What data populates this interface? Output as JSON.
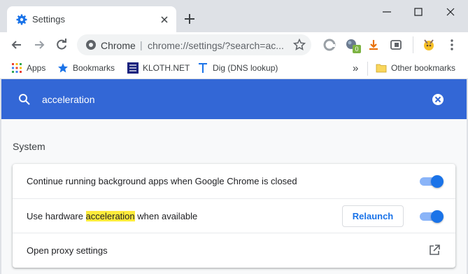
{
  "tab": {
    "title": "Settings"
  },
  "omnibox": {
    "site_label": "Chrome",
    "separator": "|",
    "url": "chrome://settings/?search=ac..."
  },
  "extensions": {
    "badge_count": "0"
  },
  "bookmarks": {
    "items": [
      "Apps",
      "Bookmarks",
      "KLOTH.NET",
      "Dig (DNS lookup)"
    ],
    "overflow": "»",
    "other": "Other bookmarks"
  },
  "search": {
    "value": "acceleration"
  },
  "section": {
    "title": "System"
  },
  "settings": {
    "background_apps": "Continue running background apps when Google Chrome is closed",
    "hw_accel_prefix": "Use hardware ",
    "hw_accel_highlight": "acceleration",
    "hw_accel_suffix": " when available",
    "relaunch_label": "Relaunch",
    "proxy": "Open proxy settings"
  },
  "colors": {
    "header_blue": "#3367d6",
    "toggle_on": "#1a73e8",
    "highlight": "#ffeb3b"
  }
}
